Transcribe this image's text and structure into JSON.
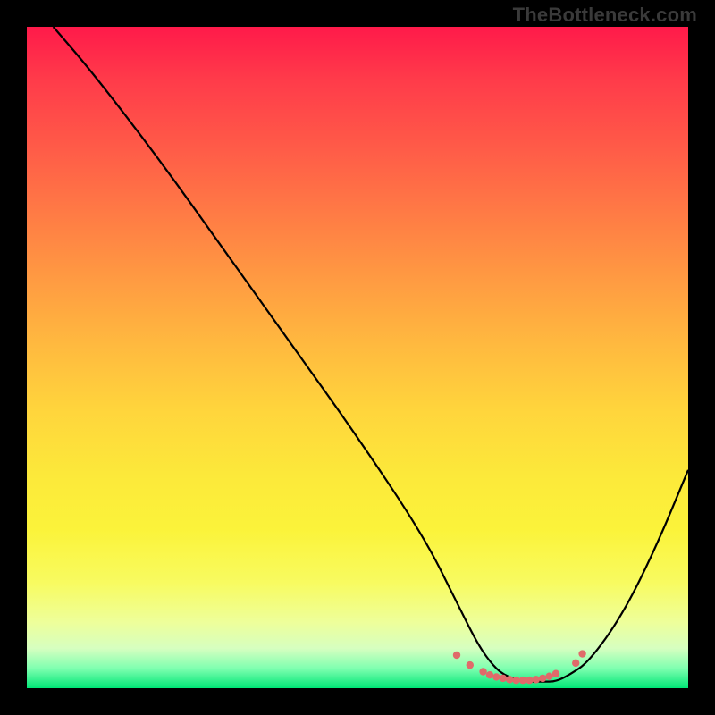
{
  "watermark": "TheBottleneck.com",
  "chart_data": {
    "type": "line",
    "title": "",
    "xlabel": "",
    "ylabel": "",
    "xlim": [
      0,
      100
    ],
    "ylim": [
      0,
      100
    ],
    "series": [
      {
        "name": "curve",
        "x": [
          4,
          10,
          20,
          30,
          40,
          50,
          60,
          65,
          68,
          70,
          72,
          75,
          78,
          80,
          82,
          85,
          90,
          95,
          100
        ],
        "y": [
          100,
          93,
          80,
          66,
          52,
          38,
          23,
          13,
          7,
          4,
          2,
          1,
          1,
          1,
          2,
          4,
          11,
          21,
          33
        ]
      }
    ],
    "markers": {
      "name": "bottom-dots",
      "color": "#e06a6a",
      "x": [
        65,
        67,
        69,
        70,
        71,
        72,
        73,
        74,
        75,
        76,
        77,
        78,
        79,
        80,
        83,
        84
      ],
      "y": [
        5,
        3.5,
        2.5,
        2,
        1.7,
        1.5,
        1.3,
        1.2,
        1.2,
        1.2,
        1.3,
        1.5,
        1.8,
        2.2,
        3.8,
        5.2
      ]
    }
  }
}
